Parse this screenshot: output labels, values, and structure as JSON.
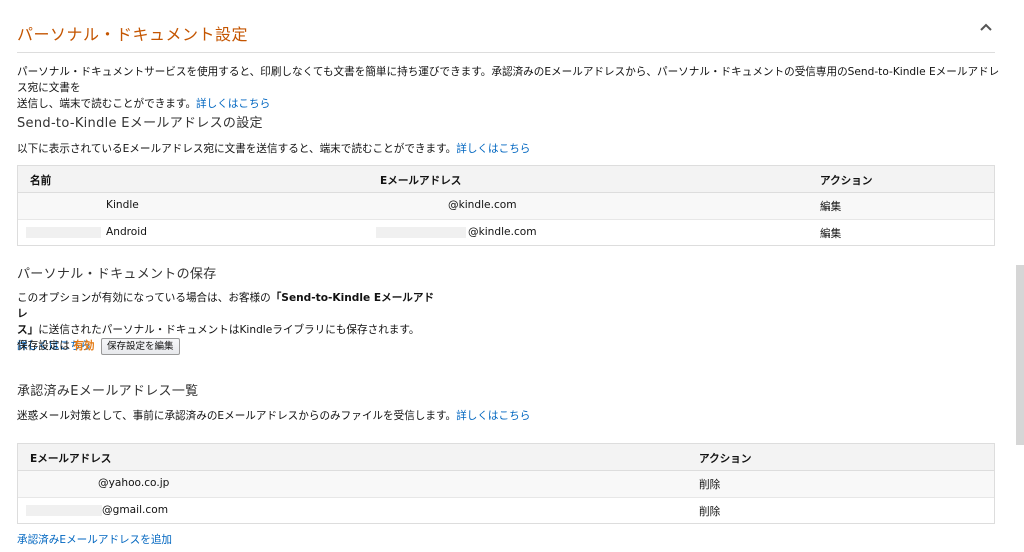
{
  "section": {
    "title": "パーソナル・ドキュメント設定",
    "intro_line1": "パーソナル・ドキュメントサービスを使用すると、印刷しなくても文書を簡単に持ち運びできます。承認済みのEメールアドレスから、パーソナル・ドキュメントの受信専用のSend-to-Kindle Eメールアドレス宛に文書を",
    "intro_line2": "送信し、端末で読むことができます。",
    "intro_link": "詳しくはこちら"
  },
  "send_to_kindle": {
    "heading": "Send-to-Kindle Eメールアドレスの設定",
    "description": "以下に表示されているEメールアドレス宛に文書を送信すると、端末で読むことができます。",
    "link": "詳しくはこちら",
    "columns": {
      "name": "名前",
      "email": "Eメールアドレス",
      "action": "アクション"
    },
    "rows": [
      {
        "name": "Kindle",
        "email": "@kindle.com",
        "action": "編集"
      },
      {
        "name": "Android",
        "email": "@kindle.com",
        "action": "編集"
      }
    ]
  },
  "archive": {
    "heading": "パーソナル・ドキュメントの保存",
    "line1_pre": "このオプションが有効になっている場合は、お客様の",
    "line1_bold": "「Send-to-Kindle Eメールアドレ",
    "line2_bold": "ス」",
    "line2_post": "に送信されたパーソナル・ドキュメントはKindleライブラリにも保存されます。",
    "link": "詳しくはこちら",
    "status_label": "保存設定は",
    "status_value": "有効",
    "edit_button": "保存設定を編集"
  },
  "approved": {
    "heading": "承認済みEメールアドレス一覧",
    "description": "迷惑メール対策として、事前に承認済みのEメールアドレスからのみファイルを受信します。",
    "link": "詳しくはこちら",
    "columns": {
      "email": "Eメールアドレス",
      "action": "アクション"
    },
    "rows": [
      {
        "email": "@yahoo.co.jp",
        "action": "削除"
      },
      {
        "email": "@gmail.com",
        "action": "削除"
      }
    ],
    "add_link": "承認済みEメールアドレスを追加"
  },
  "colors": {
    "title": "#c45500",
    "link": "#0066c0",
    "status": "#e47911"
  },
  "icons": {
    "collapse": "chevron-up-icon"
  }
}
